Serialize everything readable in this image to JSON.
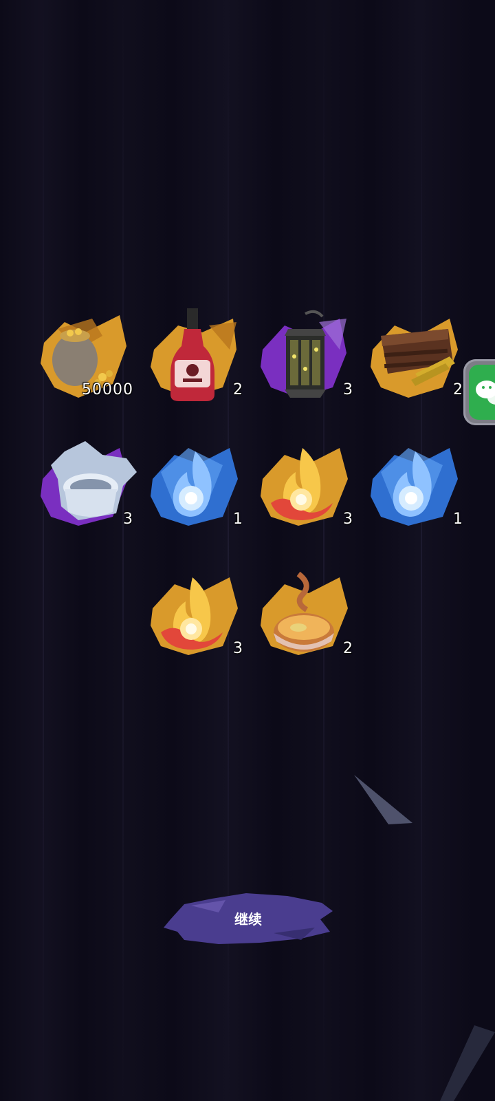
{
  "rewards": [
    {
      "name": "gold-sack",
      "count": "50000",
      "backdrop": "#d99a2b"
    },
    {
      "name": "red-potion-bottle",
      "count": "2",
      "backdrop": "#d99a2b"
    },
    {
      "name": "iron-lantern",
      "count": "3",
      "backdrop": "#7a2fc0"
    },
    {
      "name": "wooden-crate-with-gold-bars",
      "count": "2",
      "backdrop": "#d99a2b"
    },
    {
      "name": "frost-stone-cup",
      "count": "3",
      "backdrop": "#7a2fc0"
    },
    {
      "name": "blue-flame",
      "count": "1",
      "backdrop": "#2f6fd0"
    },
    {
      "name": "orange-flame",
      "count": "3",
      "backdrop": "#d99a2b"
    },
    {
      "name": "blue-flame",
      "count": "1",
      "backdrop": "#2f6fd0"
    },
    {
      "name": "orange-flame",
      "count": "3",
      "backdrop": "#d99a2b"
    },
    {
      "name": "soup-bowl",
      "count": "2",
      "backdrop": "#d99a2b"
    }
  ],
  "continue_button": {
    "label": "继续",
    "color": "#4a3d8f"
  },
  "side_tab": {
    "icon": "wechat-icon",
    "color": "#2fae4e"
  }
}
